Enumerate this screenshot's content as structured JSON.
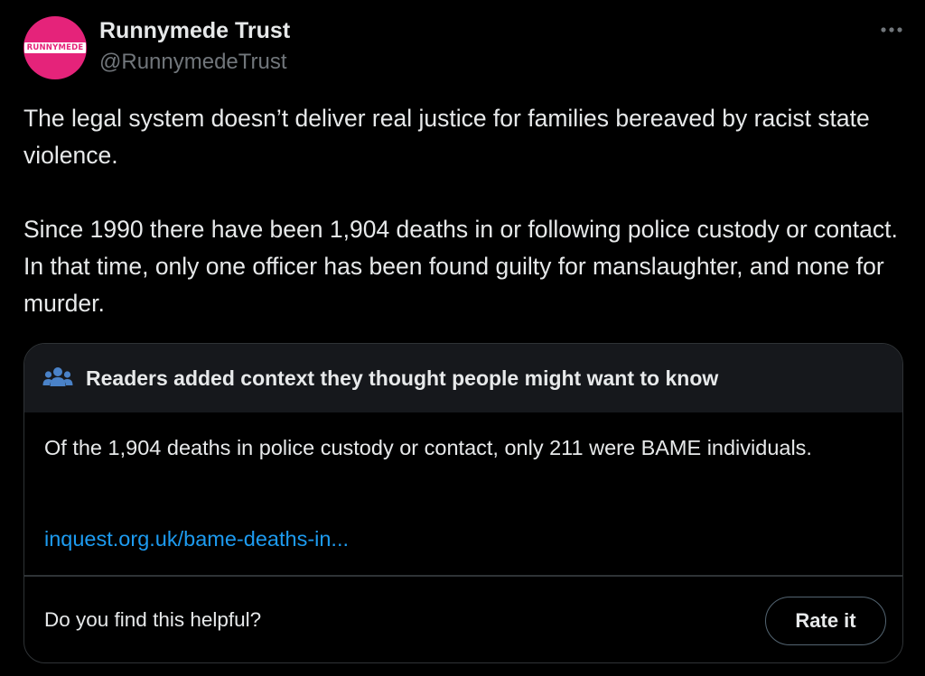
{
  "author": {
    "display_name": "Runnymede Trust",
    "handle": "@RunnymedeTrust",
    "avatar_text": "RUNNYMEDE",
    "avatar_color": "#e5237a"
  },
  "menu": {
    "icon": "more-horizontal-icon"
  },
  "tweet": {
    "paragraphs": [
      "The legal system doesn’t deliver real justice for families bereaved by racist state violence.",
      "Since 1990 there have been 1,904 deaths in or following police custody or contact. In that time, only one officer has been found guilty for manslaughter, and none for murder."
    ]
  },
  "community_note": {
    "icon": "people-icon",
    "title": "Readers added context they thought people might want to know",
    "body": "Of the 1,904 deaths in police custody or contact, only 211 were BAME individuals.",
    "link_text": "inquest.org.uk/bame-deaths-in...",
    "helpful_question": "Do you find this helpful?",
    "rate_button_label": "Rate it"
  },
  "colors": {
    "background": "#000000",
    "text_primary": "#e7e9ea",
    "text_secondary": "#71767b",
    "link": "#1d9bf0",
    "note_header_bg": "#16181c",
    "note_border": "#2f3336",
    "people_icon": "#4a82c8"
  }
}
